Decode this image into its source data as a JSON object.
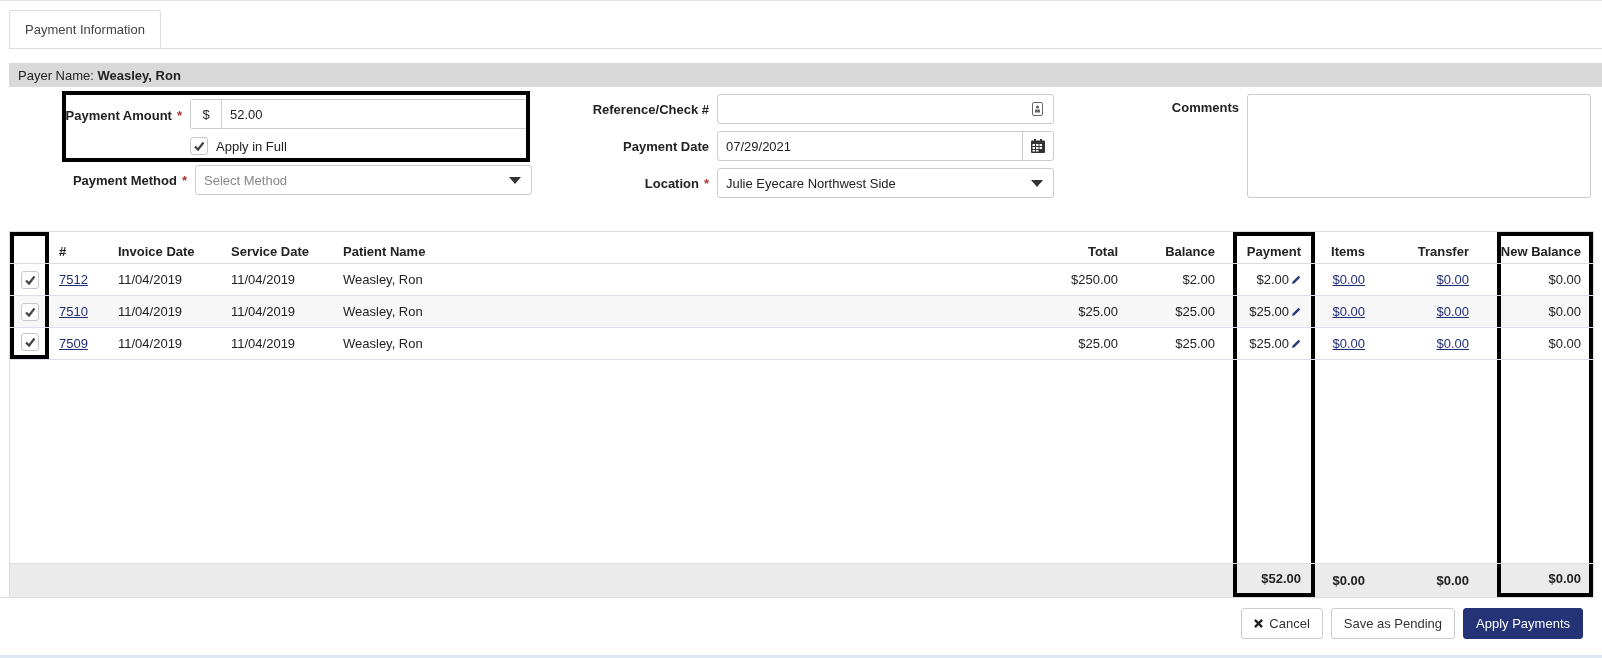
{
  "tabs": [
    {
      "label": "Payment Information",
      "selected": true
    }
  ],
  "payer": {
    "label": "Payer Name:",
    "name": "Weasley, Ron"
  },
  "payment_amount": {
    "label": "Payment Amount",
    "required_mark": "*",
    "currency": "$",
    "value": "52.00",
    "highlighted": true
  },
  "apply_in_full": {
    "label": "Apply in Full",
    "checked": true
  },
  "payment_method": {
    "label": "Payment Method",
    "required_mark": "*",
    "placeholder": "Select Method"
  },
  "reference": {
    "label": "Reference/Check #"
  },
  "payment_date": {
    "label": "Payment Date",
    "value": "07/29/2021"
  },
  "location": {
    "label": "Location",
    "required_mark": "*",
    "value": "Julie Eyecare Northwest Side"
  },
  "comments": {
    "label": "Comments"
  },
  "table": {
    "select_column": {
      "highlighted": true
    },
    "columns": [
      {
        "label": "#",
        "highlighted": false
      },
      {
        "label": "Invoice Date",
        "highlighted": false
      },
      {
        "label": "Service Date",
        "highlighted": false
      },
      {
        "label": "Patient Name",
        "highlighted": false
      },
      {
        "label": "Total",
        "highlighted": false
      },
      {
        "label": "Balance",
        "highlighted": false
      },
      {
        "label": "Payment",
        "highlighted": true
      },
      {
        "label": "Items",
        "highlighted": false
      },
      {
        "label": "Transfer",
        "highlighted": false
      },
      {
        "label": "New Balance",
        "highlighted": true
      }
    ],
    "rows": [
      {
        "checked": true,
        "number": "7512",
        "invoice_date": "11/04/2019",
        "service_date": "11/04/2019",
        "patient": "Weasley, Ron",
        "total": "$250.00",
        "balance": "$2.00",
        "payment": "$2.00",
        "items": "$0.00",
        "transfer": "$0.00",
        "new_balance": "$0.00"
      },
      {
        "checked": true,
        "number": "7510",
        "invoice_date": "11/04/2019",
        "service_date": "11/04/2019",
        "patient": "Weasley, Ron",
        "total": "$25.00",
        "balance": "$25.00",
        "payment": "$25.00",
        "items": "$0.00",
        "transfer": "$0.00",
        "new_balance": "$0.00"
      },
      {
        "checked": true,
        "number": "7509",
        "invoice_date": "11/04/2019",
        "service_date": "11/04/2019",
        "patient": "Weasley, Ron",
        "total": "$25.00",
        "balance": "$25.00",
        "payment": "$25.00",
        "items": "$0.00",
        "transfer": "$0.00",
        "new_balance": "$0.00"
      }
    ],
    "totals": {
      "payment": "$52.00",
      "items": "$0.00",
      "transfer": "$0.00",
      "new_balance": "$0.00"
    }
  },
  "buttons": [
    {
      "kind": "cancel",
      "label": "Cancel"
    },
    {
      "kind": "secondary",
      "label": "Save as Pending"
    },
    {
      "kind": "primary",
      "label": "Apply Payments"
    }
  ]
}
